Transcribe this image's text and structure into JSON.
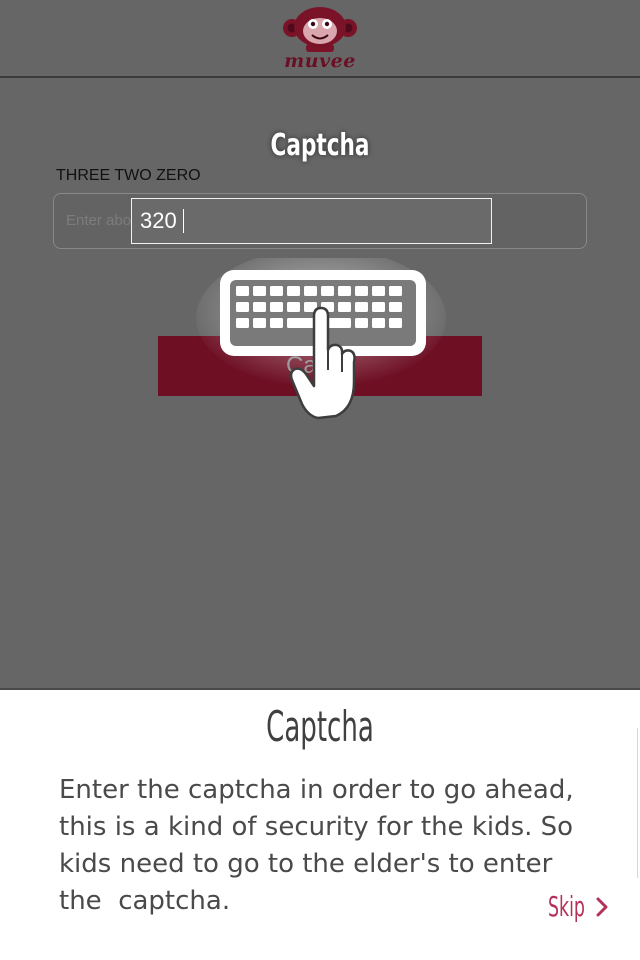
{
  "app": {
    "logo_text": "muvee",
    "brand_color": "#6e0f24",
    "accent_color": "#b4325a"
  },
  "form": {
    "title": "Captcha",
    "captcha_label": "THREE TWO ZERO",
    "input_placeholder": "Enter above code..",
    "input_value": "320",
    "submit_label": "Ca"
  },
  "hint": {
    "icon": "keyboard-tap-icon"
  },
  "tutorial": {
    "title": "Captcha",
    "text": "Enter the captcha in order to go ahead,\nthis is a kind of security for the kids. So\nkids need to go to the elder's to enter\nthe  captcha.",
    "skip_label": "Skip",
    "skip_icon": "chevron-right-icon"
  }
}
